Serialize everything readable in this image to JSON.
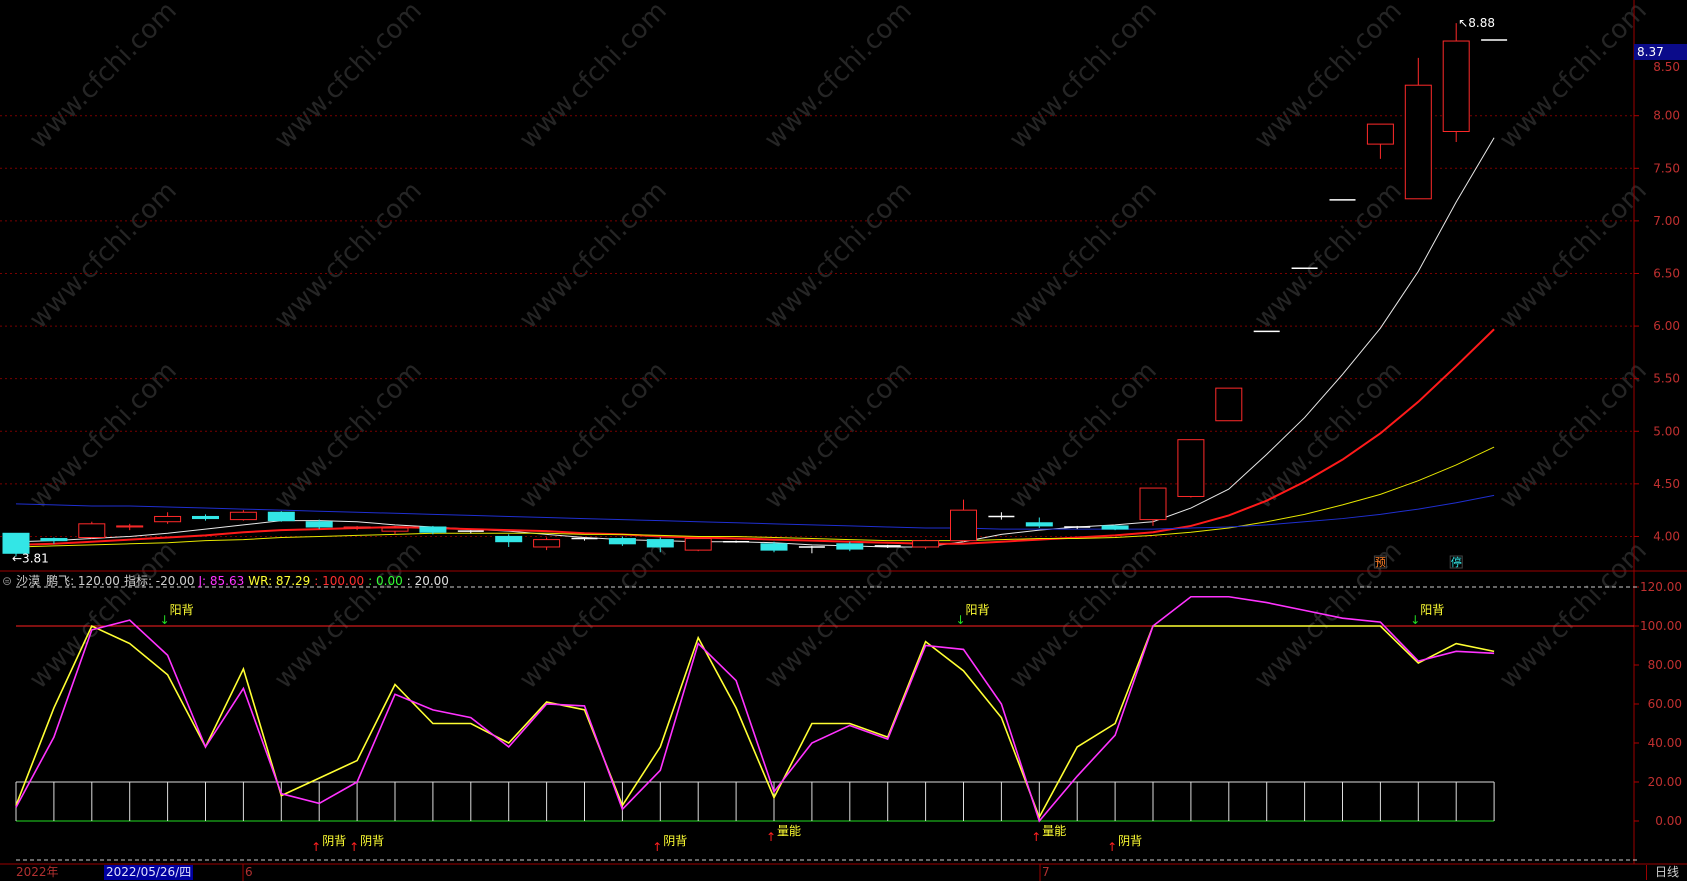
{
  "chart_data": [
    {
      "type": "candlestick",
      "ylim": [
        3.7,
        9.1
      ],
      "y_ticks": [
        4.0,
        4.5,
        5.0,
        5.5,
        6.0,
        6.5,
        7.0,
        7.5,
        8.0,
        8.37
      ],
      "y_tick_labels": [
        "4.00",
        "4.50",
        "5.00",
        "5.50",
        "6.00",
        "6.50",
        "7.00",
        "7.50",
        "8.00",
        "8.50"
      ],
      "current_price": "8.37",
      "annotations": {
        "high": "8.88",
        "low": "3.81"
      },
      "markers": [
        {
          "index": 36,
          "text": "预"
        },
        {
          "index": 38,
          "text": "停"
        }
      ],
      "candles": [
        {
          "o": 4.03,
          "c": 3.84,
          "h": 4.03,
          "l": 3.81
        },
        {
          "o": 3.98,
          "c": 3.96,
          "h": 3.99,
          "l": 3.93
        },
        {
          "o": 3.99,
          "c": 4.12,
          "h": 4.14,
          "l": 3.98
        },
        {
          "o": 4.09,
          "c": 4.1,
          "h": 4.12,
          "l": 4.06
        },
        {
          "o": 4.14,
          "c": 4.19,
          "h": 4.23,
          "l": 4.12
        },
        {
          "o": 4.19,
          "c": 4.17,
          "h": 4.21,
          "l": 4.15
        },
        {
          "o": 4.16,
          "c": 4.23,
          "h": 4.25,
          "l": 4.15
        },
        {
          "o": 4.23,
          "c": 4.15,
          "h": 4.24,
          "l": 4.14
        },
        {
          "o": 4.14,
          "c": 4.09,
          "h": 4.16,
          "l": 4.07
        },
        {
          "o": 4.08,
          "c": 4.09,
          "h": 4.1,
          "l": 4.06
        },
        {
          "o": 4.05,
          "c": 4.08,
          "h": 4.1,
          "l": 4.02
        },
        {
          "o": 4.09,
          "c": 4.04,
          "h": 4.1,
          "l": 4.02
        },
        {
          "o": 4.05,
          "c": 4.05,
          "h": 4.06,
          "l": 4.03
        },
        {
          "o": 4.0,
          "c": 3.95,
          "h": 4.02,
          "l": 3.9
        },
        {
          "o": 3.9,
          "c": 3.97,
          "h": 3.99,
          "l": 3.87
        },
        {
          "o": 3.98,
          "c": 3.98,
          "h": 3.99,
          "l": 3.96
        },
        {
          "o": 3.98,
          "c": 3.93,
          "h": 4.0,
          "l": 3.91
        },
        {
          "o": 3.97,
          "c": 3.9,
          "h": 3.99,
          "l": 3.85
        },
        {
          "o": 3.87,
          "c": 3.98,
          "h": 3.99,
          "l": 3.86
        },
        {
          "o": 3.95,
          "c": 3.95,
          "h": 3.96,
          "l": 3.94
        },
        {
          "o": 3.93,
          "c": 3.87,
          "h": 3.95,
          "l": 3.85
        },
        {
          "o": 3.9,
          "c": 3.9,
          "h": 3.91,
          "l": 3.84
        },
        {
          "o": 3.93,
          "c": 3.88,
          "h": 3.95,
          "l": 3.86
        },
        {
          "o": 3.91,
          "c": 3.91,
          "h": 3.92,
          "l": 3.89
        },
        {
          "o": 3.9,
          "c": 3.96,
          "h": 3.97,
          "l": 3.88
        },
        {
          "o": 3.96,
          "c": 4.25,
          "h": 4.35,
          "l": 3.95
        },
        {
          "o": 4.19,
          "c": 4.19,
          "h": 4.23,
          "l": 4.16
        },
        {
          "o": 4.13,
          "c": 4.1,
          "h": 4.18,
          "l": 4.08
        },
        {
          "o": 4.09,
          "c": 4.09,
          "h": 4.1,
          "l": 4.07
        },
        {
          "o": 4.1,
          "c": 4.07,
          "h": 4.11,
          "l": 4.06
        },
        {
          "o": 4.16,
          "c": 4.46,
          "h": 4.46,
          "l": 4.1
        },
        {
          "o": 4.38,
          "c": 4.92,
          "h": 4.92,
          "l": 4.37
        },
        {
          "o": 5.1,
          "c": 5.41,
          "h": 5.41,
          "l": 5.1
        },
        {
          "o": 5.95,
          "c": 5.95,
          "h": 5.95,
          "l": 5.95
        },
        {
          "o": 6.55,
          "c": 6.55,
          "h": 6.55,
          "l": 6.55
        },
        {
          "o": 7.2,
          "c": 7.2,
          "h": 7.2,
          "l": 7.2
        },
        {
          "o": 7.73,
          "c": 7.92,
          "h": 7.92,
          "l": 7.59
        },
        {
          "o": 7.21,
          "c": 8.29,
          "h": 8.55,
          "l": 7.21
        },
        {
          "o": 7.85,
          "c": 8.71,
          "h": 8.88,
          "l": 7.75
        },
        {
          "o": 8.72,
          "c": 8.72,
          "h": 8.72,
          "l": 8.72
        }
      ],
      "series": [
        {
          "name": "MA5",
          "color": "#e8e8e8",
          "values": [
            3.95,
            3.96,
            3.98,
            4.0,
            4.03,
            4.07,
            4.11,
            4.15,
            4.15,
            4.14,
            4.11,
            4.09,
            4.07,
            4.05,
            4.02,
            3.99,
            3.97,
            3.96,
            3.95,
            3.95,
            3.94,
            3.92,
            3.91,
            3.9,
            3.9,
            3.95,
            4.02,
            4.06,
            4.09,
            4.11,
            4.14,
            4.27,
            4.45,
            4.78,
            5.13,
            5.54,
            5.98,
            6.52,
            7.18,
            7.79
          ]
        },
        {
          "name": "MA10",
          "color": "#ff1a1a",
          "values": [
            3.92,
            3.93,
            3.95,
            3.97,
            3.99,
            4.01,
            4.04,
            4.06,
            4.07,
            4.08,
            4.09,
            4.08,
            4.07,
            4.06,
            4.05,
            4.03,
            4.02,
            4.0,
            3.99,
            3.98,
            3.97,
            3.96,
            3.95,
            3.94,
            3.93,
            3.93,
            3.95,
            3.97,
            3.99,
            4.01,
            4.04,
            4.1,
            4.2,
            4.34,
            4.52,
            4.73,
            4.98,
            5.28,
            5.62,
            5.97
          ]
        },
        {
          "name": "MA20",
          "color": "#e6e600",
          "values": [
            3.9,
            3.91,
            3.92,
            3.93,
            3.94,
            3.96,
            3.97,
            3.99,
            4.0,
            4.01,
            4.02,
            4.03,
            4.03,
            4.03,
            4.03,
            4.02,
            4.02,
            4.01,
            4.0,
            4.0,
            3.99,
            3.98,
            3.97,
            3.96,
            3.96,
            3.96,
            3.97,
            3.98,
            3.98,
            3.99,
            4.01,
            4.04,
            4.08,
            4.14,
            4.21,
            4.3,
            4.4,
            4.53,
            4.68,
            4.85
          ]
        },
        {
          "name": "MA60",
          "color": "#1f2fd0",
          "values": [
            4.31,
            4.3,
            4.29,
            4.29,
            4.28,
            4.27,
            4.26,
            4.25,
            4.24,
            4.23,
            4.22,
            4.21,
            4.2,
            4.19,
            4.18,
            4.17,
            4.16,
            4.15,
            4.14,
            4.13,
            4.12,
            4.11,
            4.1,
            4.09,
            4.08,
            4.08,
            4.07,
            4.07,
            4.07,
            4.07,
            4.07,
            4.08,
            4.09,
            4.11,
            4.14,
            4.17,
            4.21,
            4.26,
            4.32,
            4.39
          ]
        }
      ]
    },
    {
      "type": "line",
      "indicator": "沙漠鹏飞",
      "params": {
        "name": "沙漠",
        "label_pf": "鹏飞: 120.00",
        "label_zb": "指标: -20.00",
        "j": "J: 85.63",
        "wr": "WR: 87.29",
        "v100": ": 100.00",
        "v0": ": 0.00",
        "v20": ": 20.00"
      },
      "ylim": [
        -20,
        120
      ],
      "y_ticks": [
        120,
        100,
        80,
        60,
        40,
        20,
        0
      ],
      "y_tick_labels": [
        "120.00",
        "100.00",
        "80.00",
        "60.00",
        "40.00",
        "20.00",
        "0.00"
      ],
      "reference_lines": [
        100,
        20,
        0,
        120,
        -20
      ],
      "series": [
        {
          "name": "J",
          "color": "#ff33ff",
          "values": [
            7,
            43,
            98,
            103,
            85,
            38,
            68,
            14,
            9,
            20,
            65,
            57,
            53,
            38,
            60,
            59,
            6,
            26,
            91,
            72,
            15,
            40,
            49,
            42,
            90,
            88,
            60,
            0,
            23,
            44,
            100,
            115,
            115,
            112,
            108,
            104,
            102,
            82,
            87,
            86
          ]
        },
        {
          "name": "WR",
          "color": "#ffff33",
          "values": [
            8,
            58,
            100,
            91,
            75,
            38,
            78,
            13,
            22,
            31,
            70,
            50,
            50,
            40,
            61,
            57,
            8,
            38,
            94,
            58,
            12,
            50,
            50,
            43,
            92,
            77,
            53,
            2,
            38,
            50,
            100,
            100,
            100,
            100,
            100,
            100,
            100,
            81,
            91,
            87
          ]
        }
      ],
      "signals": [
        {
          "index": 4,
          "text": "阳背",
          "dir": "down"
        },
        {
          "index": 25,
          "text": "阳背",
          "dir": "down"
        },
        {
          "index": 37,
          "text": "阳背",
          "dir": "down"
        },
        {
          "index": 8,
          "text": "阴背",
          "dir": "up"
        },
        {
          "index": 9,
          "text": "阴背",
          "dir": "up"
        },
        {
          "index": 17,
          "text": "阴背",
          "dir": "up"
        },
        {
          "index": 20,
          "text": "量能",
          "dir": "up"
        },
        {
          "index": 27,
          "text": "量能",
          "dir": "up"
        },
        {
          "index": 29,
          "text": "阴背",
          "dir": "up"
        }
      ]
    }
  ],
  "x_labels": [
    "2022年",
    "2022/05/26/四",
    "6",
    "7"
  ],
  "period_label": "日线",
  "watermark": "www.cfchi.com"
}
